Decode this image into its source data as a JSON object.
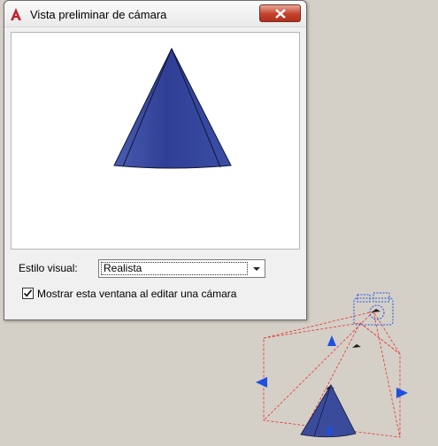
{
  "dialog": {
    "title": "Vista preliminar de cámara",
    "visual_style_label": "Estilo visual:",
    "visual_style_value": "Realista",
    "show_window_label": "Mostrar esta ventana al editar una cámara",
    "show_window_checked": true
  },
  "colors": {
    "cone": "#3a4c9e",
    "frustum": "#e8403a",
    "glyph": "#1f4fe0"
  }
}
